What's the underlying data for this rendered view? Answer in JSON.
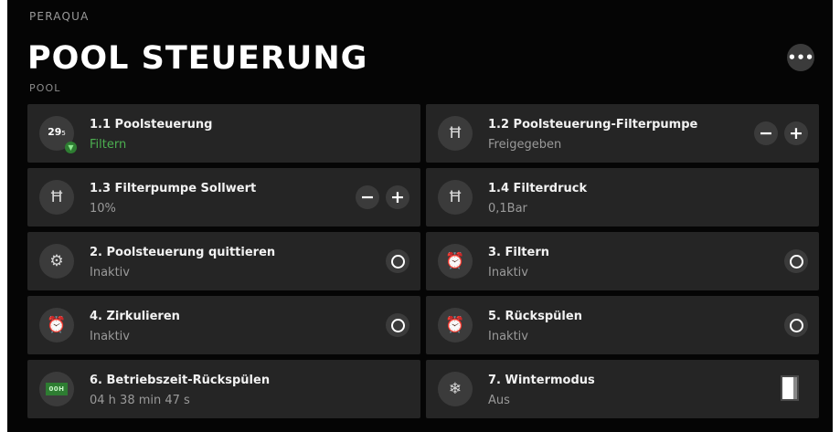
{
  "header": {
    "vendor": "PERAQUA",
    "title": "POOL STEUERUNG",
    "subtitle": "POOL",
    "more_label": "•••"
  },
  "cards": [
    {
      "name": "1.1 Poolsteuerung",
      "state": "Filtern",
      "icon": "thermometer-value",
      "temperature": "29",
      "temperature_decimal": "5",
      "badge": "filter-icon",
      "state_color": "#4caf50"
    },
    {
      "name": "1.2 Poolsteuerung-Filterpumpe",
      "state": "Freigegeben",
      "icon": "pump-icon",
      "minus": "−",
      "plus": "+"
    },
    {
      "name": "1.3 Filterpumpe Sollwert",
      "state": "10%",
      "icon": "pump-icon",
      "minus": "−",
      "plus": "+"
    },
    {
      "name": "1.4 Filterdruck",
      "state": "0,1Bar",
      "icon": "pump-icon"
    },
    {
      "name": "2. Poolsteuerung quittieren",
      "state": "Inaktiv",
      "icon": "gears-icon",
      "toggle": "circle"
    },
    {
      "name": "3. Filtern",
      "state": "Inaktiv",
      "icon": "alarm-clock-icon",
      "toggle": "circle"
    },
    {
      "name": "4. Zirkulieren",
      "state": "Inaktiv",
      "icon": "alarm-clock-icon",
      "toggle": "circle"
    },
    {
      "name": "5. Rückspülen",
      "state": "Inaktiv",
      "icon": "alarm-clock-icon",
      "toggle": "circle"
    },
    {
      "name": "6. Betriebszeit-Rückspülen",
      "state": "04 h 38 min 47 s",
      "icon": "counter-icon",
      "counter_text": "00H"
    },
    {
      "name": "7. Wintermodus",
      "state": "Aus",
      "icon": "snowflake-icon",
      "toggle": "switch"
    }
  ],
  "icons": {
    "pump": "Ħ",
    "gears": "⚙",
    "alarm": "⏰",
    "snow": "❄",
    "filter": "▼"
  },
  "colors": {
    "background": "#050505",
    "card": "#252525",
    "button": "#3b3b3b",
    "active_state": "#4caf50"
  }
}
